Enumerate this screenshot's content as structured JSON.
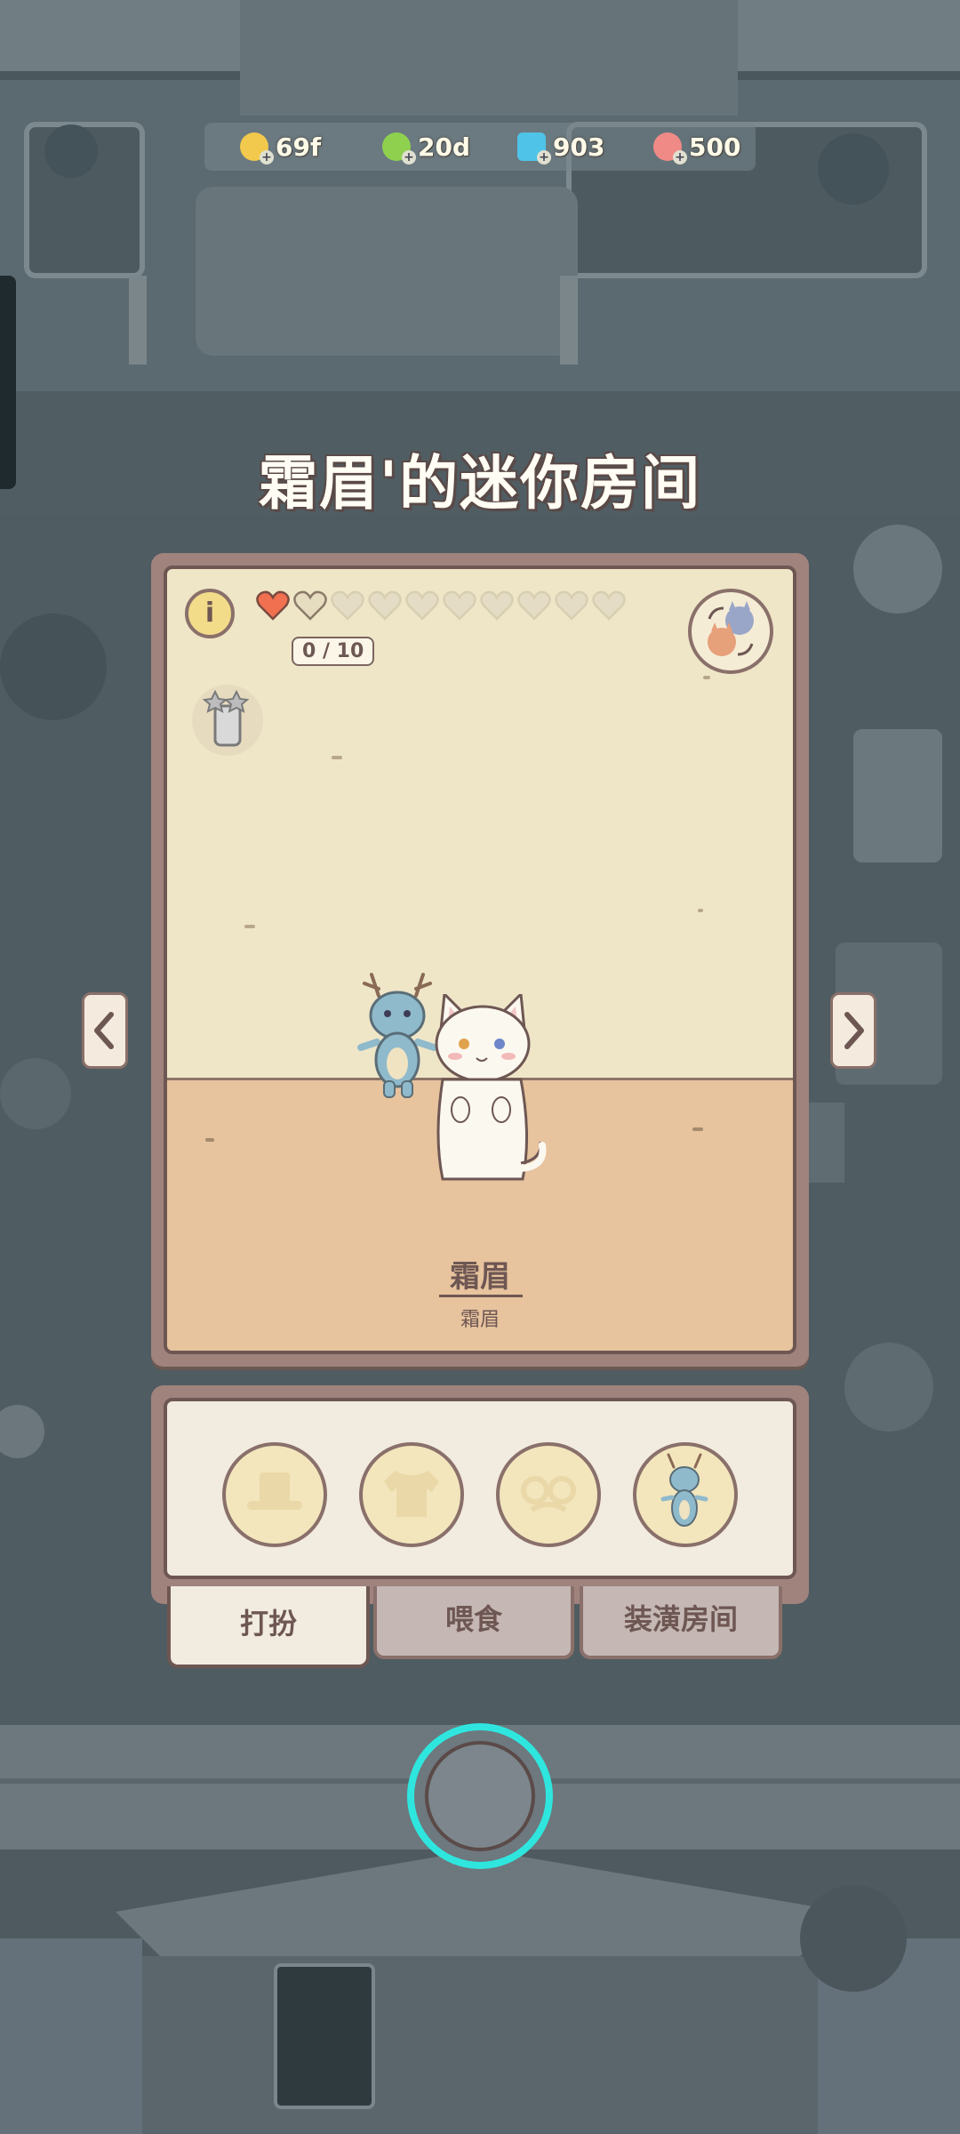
{
  "resources": [
    {
      "name": "coin",
      "value": "69f",
      "color": "#f2c94c"
    },
    {
      "name": "energy",
      "value": "20d",
      "color": "#8fd14f"
    },
    {
      "name": "gem",
      "value": "903",
      "color": "#4fc3e8"
    },
    {
      "name": "fish",
      "value": "500",
      "color": "#f08a86"
    }
  ],
  "title": "霜眉'的迷你房间",
  "room": {
    "info_label": "i",
    "affection": {
      "filled": 1,
      "total": 10,
      "count_text": "0 / 10"
    },
    "cat_name": "霜眉",
    "cat_subname": "霜眉"
  },
  "nav": {
    "prev": "‹",
    "next": "›"
  },
  "item_slots": [
    "hat-icon",
    "shirt-icon",
    "glasses-icon",
    "dragon-toy-icon"
  ],
  "tabs": [
    {
      "label": "打扮",
      "active": true
    },
    {
      "label": "喂食",
      "active": false
    },
    {
      "label": "装潢房间",
      "active": false
    }
  ],
  "colors": {
    "accent_ring": "#2fe6df",
    "heart": "#f07050",
    "frame": "#a0837d"
  }
}
